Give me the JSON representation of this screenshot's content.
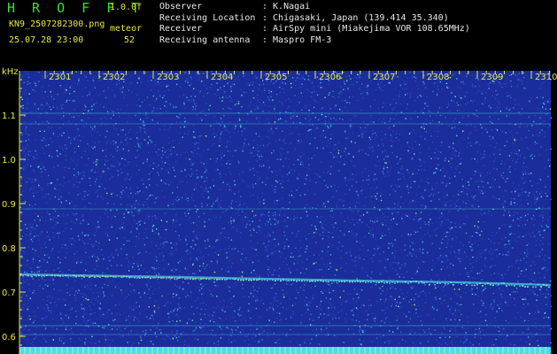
{
  "header": {
    "app_title": "H R O F F T",
    "version": "1.0.0f",
    "filename": "KN9_2507282300.png",
    "datetime": "25.07.28 23:00",
    "meteor_label": "meteor",
    "meteor_count": "52",
    "info": [
      {
        "key": "Observer",
        "value": ": K.Nagai"
      },
      {
        "key": "Receiving Location",
        "value": ": Chigasaki, Japan (139.414 35.340)"
      },
      {
        "key": "Receiver",
        "value": ": AirSpy mini (Miakejima VOR 108.65MHz)"
      },
      {
        "key": "Receiving antenna",
        "value": ": Maspro FM-3"
      }
    ]
  },
  "spectrogram": {
    "y_unit": "kHz",
    "y_ticks": [
      "1.1",
      "1.0",
      "0.9",
      "0.8",
      "0.7",
      "0.6"
    ],
    "x_ticks": [
      "2301",
      "2302",
      "2303",
      "2304",
      "2305",
      "2306",
      "2307",
      "2308",
      "2309",
      "2310"
    ],
    "colors": {
      "background": "#1a2d9a",
      "noise": [
        "#2b49c8",
        "#3f7ad8",
        "#49b8d8",
        "#6ee0c8",
        "#d8e85a"
      ],
      "axis": "#e8e84a",
      "bottom_bar": "#3fe0ff"
    }
  }
}
